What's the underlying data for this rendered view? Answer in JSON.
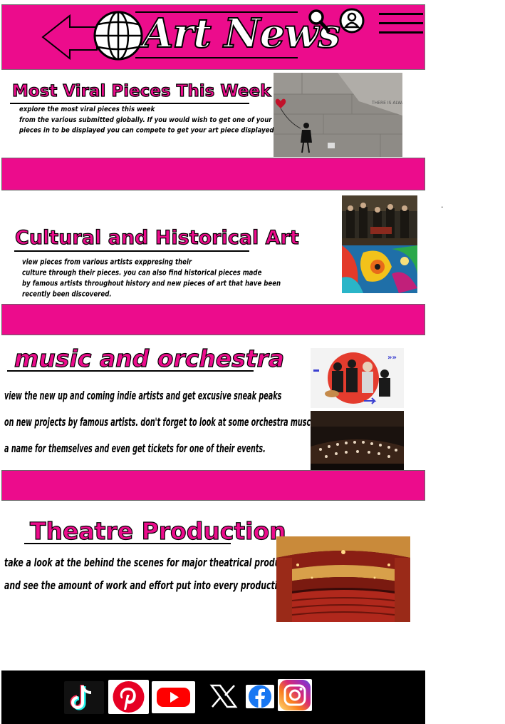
{
  "header": {
    "logo_text": "Art News",
    "search_icon": "search-icon",
    "account_icon": "user-circle-icon",
    "menu_icon": "hamburger-menu-icon",
    "brand_color": "#ec0c8c"
  },
  "sections": [
    {
      "title": "Most Viral Pieces This Week",
      "lines": [
        "explore the most viral pieces this week",
        "from the various submitted globally. If you would wish to get one of your",
        "pieces in to be displayed you can compete to get your art piece displayed."
      ]
    },
    {
      "title": "Cultural and Historical  Art",
      "lines": [
        "view pieces from various  artists exppresing their",
        "culture through  their pieces. you can also find  historical pieces made",
        "by famous artists throughout history and new pieces of art that have been",
        "recently been discovered."
      ]
    },
    {
      "title": "music and orchestra",
      "lines": [
        "view the new  up and coming indie artists and get excusive sneak peaks",
        "on new projects by famous artists. don't forget to look at some orchestra muscians making",
        "a name for themselves and even get tickets for one of their events."
      ]
    },
    {
      "title": "Theatre Production",
      "lines": [
        "take a look at the behind the scenes for major theatrical productions",
        "and see the amount of work and effort put  into every production."
      ]
    }
  ],
  "stray_mark": ".",
  "footer": {
    "socials": [
      "tiktok-icon",
      "pinterest-icon",
      "youtube-icon",
      "x-icon",
      "facebook-icon",
      "instagram-icon"
    ]
  }
}
